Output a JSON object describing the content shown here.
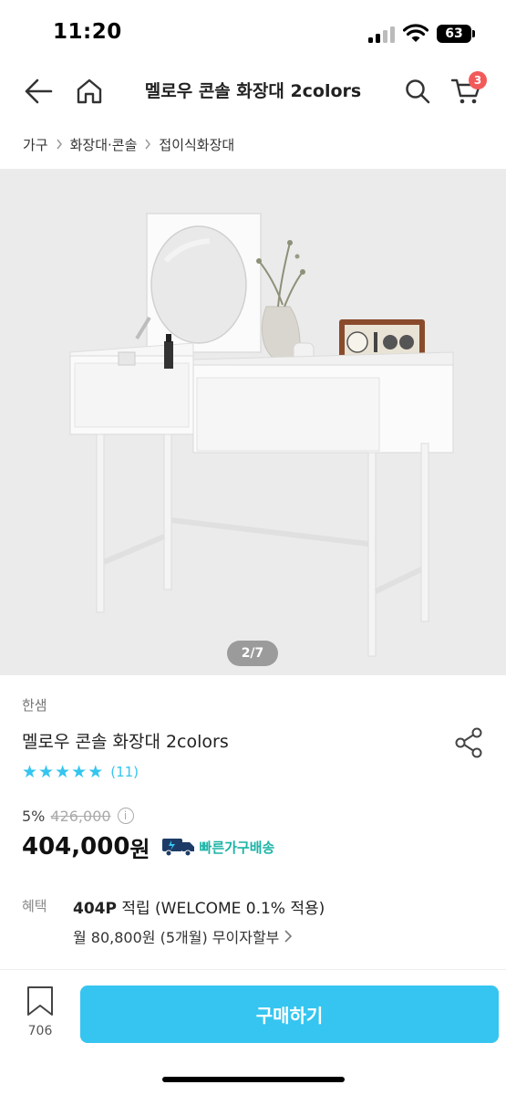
{
  "status_bar": {
    "time": "11:20",
    "battery": "63"
  },
  "header": {
    "title": "멜로우 콘솔 화장대 2colors",
    "cart_count": "3"
  },
  "breadcrumb": [
    "가구",
    "화장대·콘솔",
    "접이식화장대"
  ],
  "gallery": {
    "counter": "2/7"
  },
  "product": {
    "brand": "한샘",
    "name": "멜로우 콘솔 화장대 2colors",
    "rating_stars": 5,
    "review_count": "(11)",
    "discount": "5%",
    "original_price": "426,000",
    "price": "404,000",
    "price_unit": "원",
    "delivery_badge": "빠른가구배송"
  },
  "benefit": {
    "label": "혜택",
    "points": "404P",
    "points_text": " 적립 (WELCOME 0.1% 적용)",
    "installment": "월 80,800원 (5개월) 무이자할부"
  },
  "bottom": {
    "bookmark_count": "706",
    "buy_label": "구매하기"
  },
  "colors": {
    "accent": "#35c5f0",
    "badge": "#f25a5a",
    "delivery": "#1bb3a5"
  }
}
